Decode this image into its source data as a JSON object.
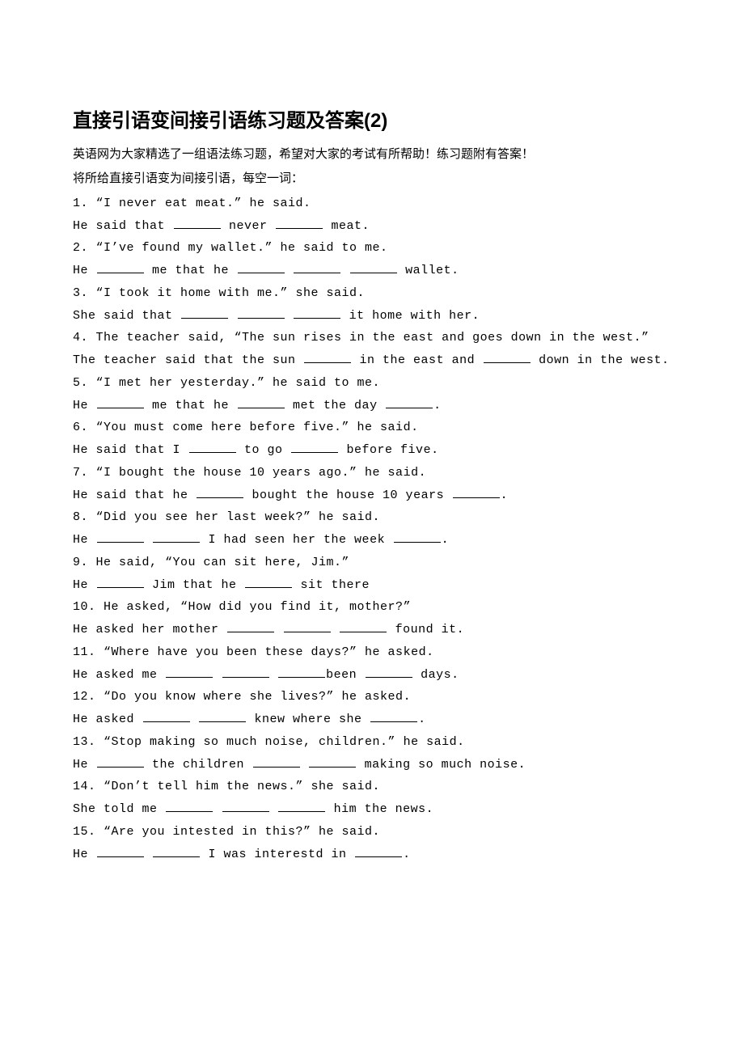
{
  "title": "直接引语变间接引语练习题及答案(2)",
  "intro": "英语网为大家精选了一组语法练习题，希望对大家的考试有所帮助！练习题附有答案！",
  "sub": "将所给直接引语变为间接引语，每空一词：",
  "blank_widths": {
    "w1": 58
  },
  "items": [
    {
      "n": "1",
      "q": "“I never eat meat.” he said.",
      "a_segments": [
        "He said that ",
        "__",
        " never ",
        "__",
        " meat."
      ]
    },
    {
      "n": "2",
      "q": "“I’ve found my wallet.” he said to me.",
      "a_segments": [
        "He ",
        "__",
        " me that he ",
        "__",
        " ",
        "__",
        " ",
        "__",
        " wallet."
      ]
    },
    {
      "n": "3",
      "q": "“I took it home with me.” she said.",
      "a_segments": [
        "She said that ",
        "__",
        " ",
        "__",
        " ",
        "__",
        " it home with her."
      ]
    },
    {
      "n": "4",
      "q": "The teacher said, “The sun rises in the east and goes down in the west.”",
      "a_segments": [
        "The teacher said that the sun ",
        "__",
        " in the east and ",
        "__",
        " down in the west."
      ]
    },
    {
      "n": "5",
      "q": "“I met her yesterday.” he said to me.",
      "a_segments": [
        "He ",
        "__",
        " me that he ",
        "__",
        " met the day ",
        "__",
        "."
      ]
    },
    {
      "n": "6",
      "q": "“You must come here before five.” he said.",
      "a_segments": [
        "He said that I ",
        "__",
        " to go ",
        "__",
        " before five."
      ]
    },
    {
      "n": "7",
      "q": "“I bought the house 10 years ago.” he said.",
      "a_segments": [
        "He said that he ",
        "__",
        " bought the house 10 years ",
        "__",
        "."
      ]
    },
    {
      "n": "8",
      "q": "“Did you see her last week?” he said.",
      "a_segments": [
        "He ",
        "__",
        " ",
        "__",
        " I had seen her the week ",
        "__",
        "."
      ]
    },
    {
      "n": "9",
      "q": "He said, “You can sit here, Jim.”",
      "a_segments": [
        "He ",
        "__",
        " Jim that he ",
        "__",
        " sit there"
      ]
    },
    {
      "n": "10",
      "q": "He asked, “How did you find it, mother?”",
      "a_segments": [
        "He asked her mother ",
        "__",
        " ",
        "__",
        " ",
        "__",
        " found it."
      ]
    },
    {
      "n": "11",
      "q": "“Where have you been these days?” he asked.",
      "a_segments": [
        "He asked me ",
        "__",
        " ",
        "__",
        " ",
        "__",
        "been ",
        "__",
        " days."
      ]
    },
    {
      "n": "12",
      "q": "“Do you know where she lives?” he asked.",
      "a_segments": [
        "He asked ",
        "__",
        " ",
        "__",
        " knew where she ",
        "__",
        "."
      ]
    },
    {
      "n": "13",
      "q": "“Stop making so much noise, children.” he said.",
      "a_segments": [
        "He ",
        "__",
        " the children ",
        "__",
        " ",
        "__",
        " making so much noise."
      ]
    },
    {
      "n": "14",
      "q": "“Don’t tell him the news.” she said.",
      "a_segments": [
        "She told me ",
        "__",
        " ",
        "__",
        " ",
        "__",
        " him the news."
      ]
    },
    {
      "n": "15",
      "q": "“Are you intested in this?” he said.",
      "a_segments": [
        "He ",
        "__",
        " ",
        "__",
        " I was interestd in ",
        "__",
        "."
      ]
    }
  ]
}
